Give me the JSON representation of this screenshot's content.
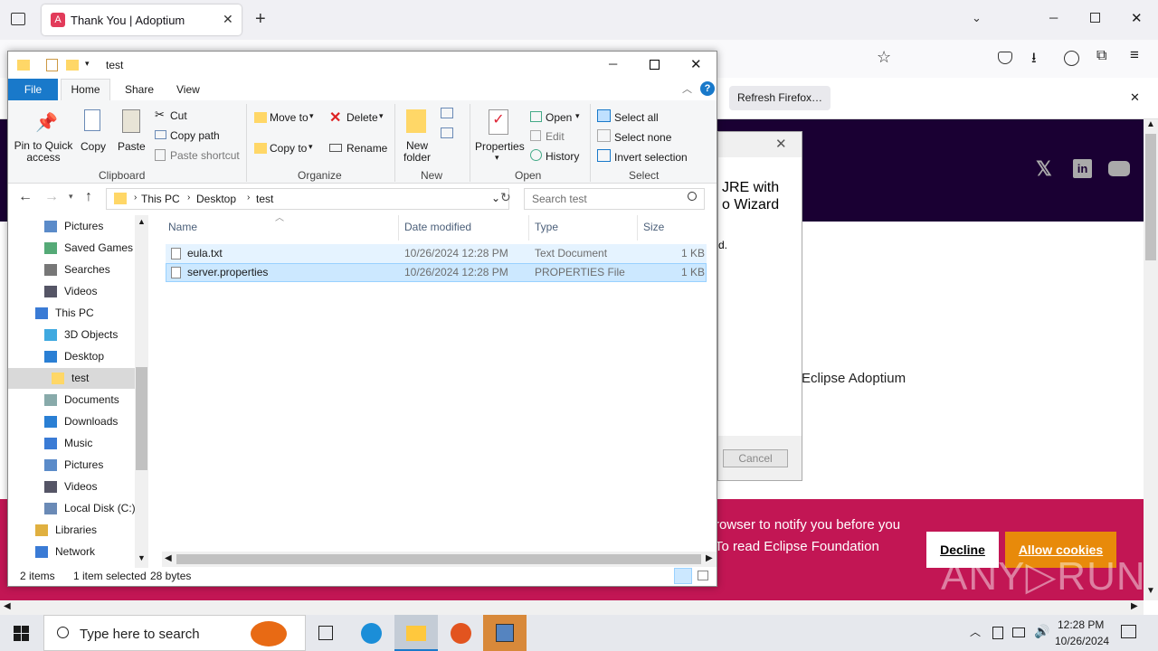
{
  "browser": {
    "tab_title": "Thank You | Adoptium",
    "refresh_label": "Refresh Firefox…"
  },
  "website": {
    "partial_heading_1": "JRE with",
    "partial_heading_2": "o Wizard",
    "partial_text_d": "d.",
    "partial_text_eclipse": "Eclipse Adoptium",
    "cookie_line_1": "rowser to notify you before you",
    "cookie_line_2": "To read Eclipse Foundation",
    "decline": "Decline",
    "allow": "Allow cookies"
  },
  "wizard": {
    "cancel": "Cancel"
  },
  "explorer": {
    "title": "test",
    "tabs": [
      "File",
      "Home",
      "Share",
      "View"
    ],
    "clipboard": {
      "pin": "Pin to Quick access",
      "copy": "Copy",
      "paste": "Paste",
      "cut": "Cut",
      "copy_path": "Copy path",
      "paste_shortcut": "Paste shortcut",
      "group": "Clipboard"
    },
    "organize": {
      "move_to": "Move to",
      "copy_to": "Copy to",
      "delete": "Delete",
      "rename": "Rename",
      "group": "Organize"
    },
    "new": {
      "new_folder": "New folder",
      "group": "New"
    },
    "open": {
      "properties": "Properties",
      "open": "Open",
      "edit": "Edit",
      "history": "History",
      "group": "Open"
    },
    "select": {
      "select_all": "Select all",
      "select_none": "Select none",
      "invert": "Invert selection",
      "group": "Select"
    },
    "breadcrumb": [
      "This PC",
      "Desktop",
      "test"
    ],
    "search_placeholder": "Search test",
    "nav": [
      {
        "label": "Pictures",
        "indent": 2
      },
      {
        "label": "Saved Games",
        "indent": 2
      },
      {
        "label": "Searches",
        "indent": 2
      },
      {
        "label": "Videos",
        "indent": 2
      },
      {
        "label": "This PC",
        "indent": 1
      },
      {
        "label": "3D Objects",
        "indent": 2
      },
      {
        "label": "Desktop",
        "indent": 2
      },
      {
        "label": "test",
        "indent": 3
      },
      {
        "label": "Documents",
        "indent": 2
      },
      {
        "label": "Downloads",
        "indent": 2
      },
      {
        "label": "Music",
        "indent": 2
      },
      {
        "label": "Pictures",
        "indent": 2
      },
      {
        "label": "Videos",
        "indent": 2
      },
      {
        "label": "Local Disk (C:)",
        "indent": 2
      },
      {
        "label": "Libraries",
        "indent": 1
      },
      {
        "label": "Network",
        "indent": 1
      }
    ],
    "columns": {
      "name": "Name",
      "date": "Date modified",
      "type": "Type",
      "size": "Size"
    },
    "files": [
      {
        "name": "eula.txt",
        "date": "10/26/2024 12:28 PM",
        "type": "Text Document",
        "size": "1 KB"
      },
      {
        "name": "server.properties",
        "date": "10/26/2024 12:28 PM",
        "type": "PROPERTIES File",
        "size": "1 KB"
      }
    ],
    "status": {
      "items": "2 items",
      "selected": "1 item selected",
      "bytes": "28 bytes"
    }
  },
  "taskbar": {
    "search_placeholder": "Type here to search",
    "time": "12:28 PM",
    "date": "10/26/2024"
  },
  "colors": {
    "accent": "#1979ca",
    "header": "#1a0033",
    "cookie": "#c21654",
    "allow": "#e88a0a",
    "selection": "#cce8ff"
  }
}
